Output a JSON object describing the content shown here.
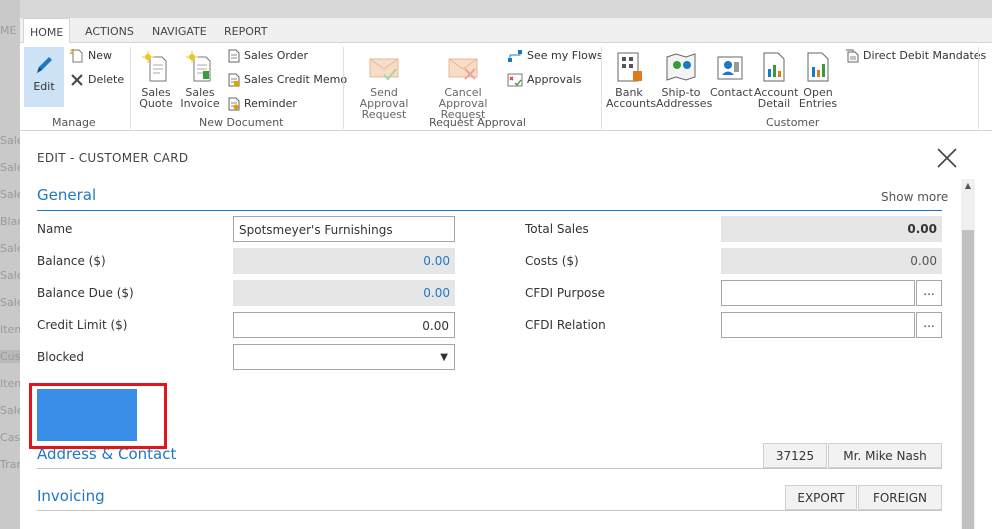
{
  "bg_left_items": [
    "ME",
    "Sale",
    "Sale",
    "Sale",
    "Blan",
    "Sale",
    "Sale",
    "Sale",
    "Item",
    "Cust",
    "Item",
    "Sale",
    "Cas",
    "Tran"
  ],
  "tabs": {
    "home": "HOME",
    "actions": "ACTIONS",
    "navigate": "NAVIGATE",
    "report": "REPORT"
  },
  "ribbon": {
    "manage": {
      "label": "Manage",
      "edit": "Edit",
      "new": "New",
      "delete": "Delete"
    },
    "new_document": {
      "label": "New Document",
      "sales_quote_l1": "Sales",
      "sales_quote_l2": "Quote",
      "sales_invoice_l1": "Sales",
      "sales_invoice_l2": "Invoice",
      "sales_order": "Sales Order",
      "sales_credit_memo": "Sales Credit Memo",
      "reminder": "Reminder"
    },
    "request_approval": {
      "label": "Request Approval",
      "send_l1": "Send Approval",
      "send_l2": "Request",
      "cancel_l1": "Cancel Approval",
      "cancel_l2": "Request",
      "see_my_flows": "See my Flows",
      "approvals": "Approvals"
    },
    "customer": {
      "label": "Customer",
      "bank_l1": "Bank",
      "bank_l2": "Accounts",
      "shipto_l1": "Ship-to",
      "shipto_l2": "Addresses",
      "contact": "Contact",
      "account_l1": "Account",
      "account_l2": "Detail",
      "open_l1": "Open",
      "open_l2": "Entries",
      "direct_debit": "Direct Debit Mandates"
    }
  },
  "card": {
    "title": "EDIT - CUSTOMER CARD",
    "general": {
      "title": "General",
      "show_more": "Show more",
      "name_label": "Name",
      "name_value": "Spotsmeyer's Furnishings",
      "balance_label": "Balance ($)",
      "balance_value": "0.00",
      "balance_due_label": "Balance Due ($)",
      "balance_due_value": "0.00",
      "credit_limit_label": "Credit Limit ($)",
      "credit_limit_value": "0.00",
      "blocked_label": "Blocked",
      "blocked_value": "",
      "total_sales_label": "Total Sales",
      "total_sales_value": "0.00",
      "costs_label": "Costs ($)",
      "costs_value": "0.00",
      "cfdi_purpose_label": "CFDI Purpose",
      "cfdi_purpose_value": "",
      "cfdi_relation_label": "CFDI Relation",
      "cfdi_relation_value": "",
      "lookup": "..."
    },
    "address": {
      "title": "Address & Contact",
      "code": "37125",
      "contact": "Mr. Mike Nash"
    },
    "invoicing": {
      "title": "Invoicing",
      "export": "EXPORT",
      "foreign": "FOREIGN"
    }
  },
  "colors": {
    "accent": "#1b78c6",
    "highlight": "#e2151a",
    "redacted_block": "#3a8ee8"
  }
}
